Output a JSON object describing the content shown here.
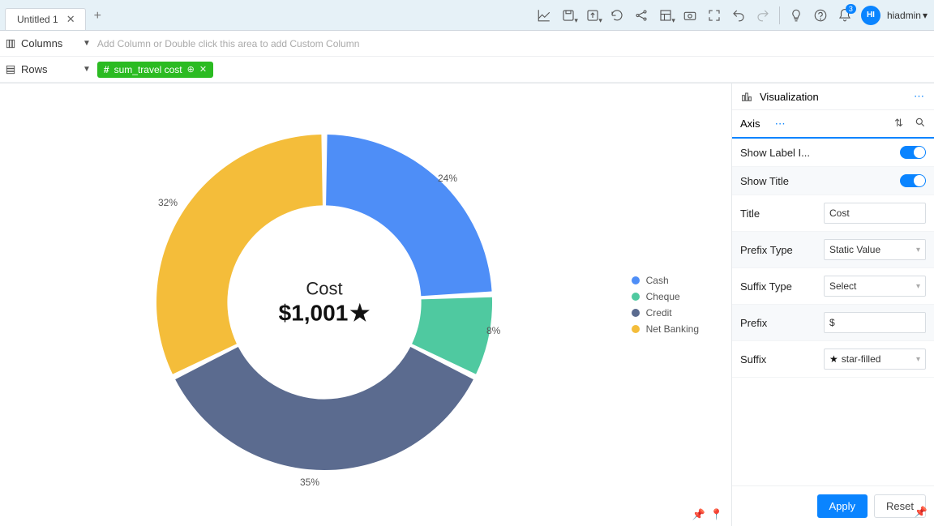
{
  "tab": {
    "title": "Untitled 1"
  },
  "user": {
    "initials": "HI",
    "name": "hiadmin"
  },
  "notifications": {
    "count": "3"
  },
  "shelves": {
    "columns_label": "Columns",
    "columns_placeholder": "Add Column or Double click this area to add Custom Column",
    "rows_label": "Rows",
    "pill_label": "sum_travel cost"
  },
  "legend": {
    "items": [
      {
        "label": "Cash",
        "color": "#4e8ef7"
      },
      {
        "label": "Cheque",
        "color": "#4fc9a0"
      },
      {
        "label": "Credit",
        "color": "#5b6b8f"
      },
      {
        "label": "Net Banking",
        "color": "#f4bd3a"
      }
    ]
  },
  "center": {
    "title": "Cost",
    "value": "$1,001"
  },
  "labels": {
    "l1": "24%",
    "l2": "8%",
    "l3": "35%",
    "l4": "32%"
  },
  "panel": {
    "heading": "Visualization",
    "axis_label": "Axis",
    "show_label_inside": "Show Label I...",
    "show_title": "Show Title",
    "title_lbl": "Title",
    "title_val": "Cost",
    "prefix_type_lbl": "Prefix Type",
    "prefix_type_val": "Static Value",
    "suffix_type_lbl": "Suffix Type",
    "suffix_type_val": "Select",
    "prefix_lbl": "Prefix",
    "prefix_val": "$",
    "suffix_lbl": "Suffix",
    "suffix_val": "star-filled",
    "apply": "Apply",
    "reset": "Reset"
  },
  "chart_data": {
    "type": "pie",
    "title": "Cost",
    "center_value": 1001,
    "center_prefix": "$",
    "center_suffix": "star-filled",
    "series": [
      {
        "name": "Cash",
        "value": 24,
        "color": "#4e8ef7"
      },
      {
        "name": "Cheque",
        "value": 8,
        "color": "#4fc9a0"
      },
      {
        "name": "Credit",
        "value": 35,
        "color": "#5b6b8f"
      },
      {
        "name": "Net Banking",
        "value": 32,
        "color": "#f4bd3a"
      }
    ],
    "unit": "percent",
    "donut": true
  }
}
